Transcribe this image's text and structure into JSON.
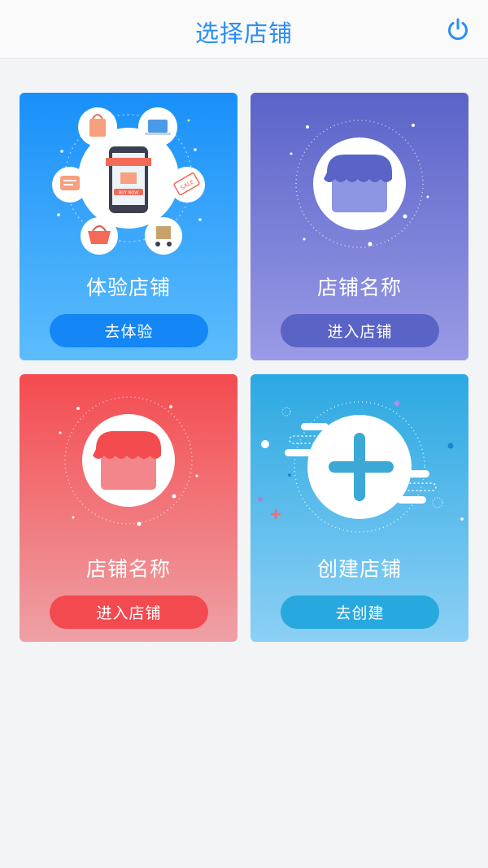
{
  "header": {
    "title": "选择店铺",
    "power_icon": "power-icon"
  },
  "cards": [
    {
      "title": "体验店铺",
      "button": "去体验",
      "illustration": "shopping-illustration",
      "accent": "#1890fa",
      "art_text": {
        "buy_now": "BUY NOW",
        "sale": "SALE"
      }
    },
    {
      "title": "店铺名称",
      "button": "进入店铺",
      "illustration": "storefront-icon",
      "accent": "#5a63c8"
    },
    {
      "title": "店铺名称",
      "button": "进入店铺",
      "illustration": "storefront-icon",
      "accent": "#f44b4f"
    },
    {
      "title": "创建店铺",
      "button": "去创建",
      "illustration": "plus-icon",
      "accent": "#2ba8e2"
    }
  ]
}
